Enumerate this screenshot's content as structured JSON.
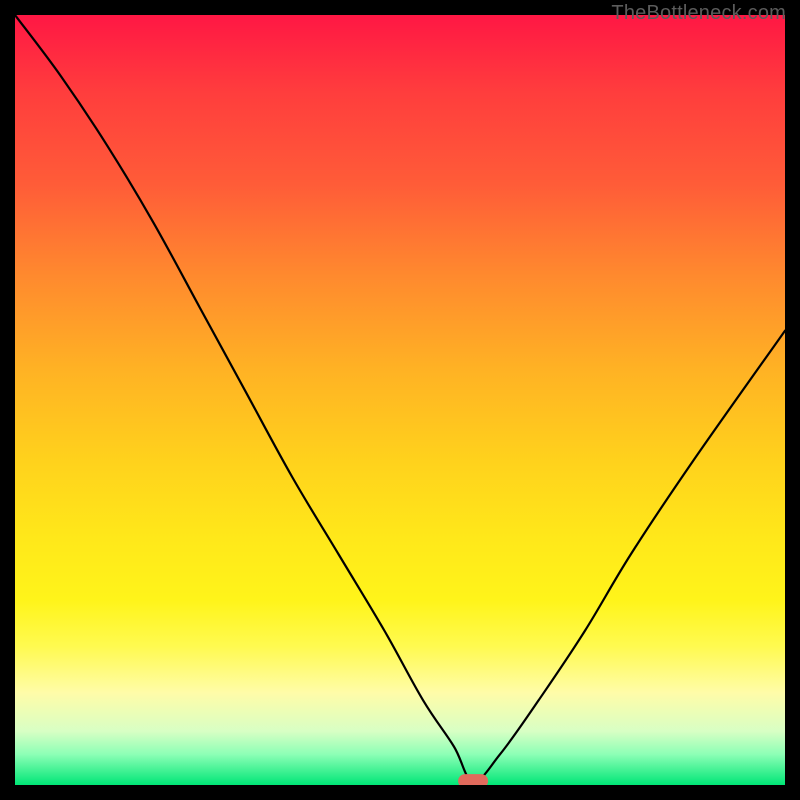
{
  "attribution": "TheBottleneck.com",
  "colors": {
    "background": "#000000",
    "curve": "#000000",
    "marker": "#e06a5c"
  },
  "chart_data": {
    "type": "line",
    "title": "",
    "xlabel": "",
    "ylabel": "",
    "xlim": [
      0,
      100
    ],
    "ylim": [
      0,
      100
    ],
    "grid": false,
    "legend": false,
    "series": [
      {
        "name": "bottleneck-curve",
        "x": [
          0,
          6,
          12,
          18,
          24,
          30,
          36,
          42,
          48,
          53,
          57,
          59.5,
          63,
          68,
          74,
          80,
          88,
          100
        ],
        "y": [
          100,
          92,
          83,
          73,
          62,
          51,
          40,
          30,
          20,
          11,
          5,
          0.5,
          4,
          11,
          20,
          30,
          42,
          59
        ]
      }
    ],
    "annotations": [
      {
        "name": "marker",
        "x": 59.5,
        "y": 0.5,
        "shape": "pill",
        "color": "#e06a5c"
      }
    ]
  }
}
